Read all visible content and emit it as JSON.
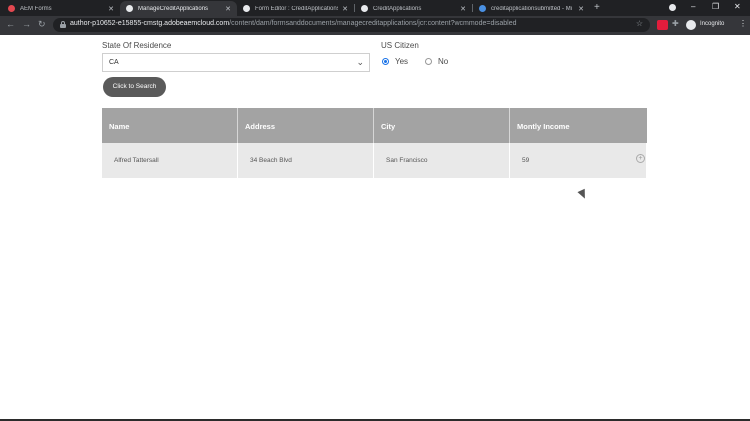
{
  "browser": {
    "tabs": [
      {
        "title": "AEM Forms",
        "icon": "adobe-icon",
        "color": "#e34850",
        "active": false
      },
      {
        "title": "ManageCreditApplications",
        "icon": "globe-icon",
        "color": "#e8eaed",
        "active": true
      },
      {
        "title": "Form Editor : CreditApplications",
        "icon": "globe-icon",
        "color": "#e8eaed",
        "active": false
      },
      {
        "title": "CreditApplications",
        "icon": "globe-icon",
        "color": "#e8eaed",
        "active": false
      },
      {
        "title": "creditapplicationsubmitted - Mi",
        "icon": "azure-icon",
        "color": "#4a90e2",
        "active": false
      }
    ],
    "new_tab": "+",
    "window_controls": {
      "minimize": "–",
      "maximize": "❐",
      "close": "✕"
    },
    "url_host": "author-p10652-e15855-cmstg.adobeaemcloud.com",
    "url_path": "/content/dam/formsanddocuments/managecreditapplications/jcr:content?wcmmode=disabled",
    "incognito_label": "Incognito"
  },
  "form": {
    "state_label": "State Of Residence",
    "state_value": "CA",
    "citizen_label": "US Citizen",
    "citizen_options": [
      "Yes",
      "No"
    ],
    "citizen_selected": "Yes",
    "search_button": "Click to Search"
  },
  "table": {
    "columns": [
      "Name",
      "Address",
      "City",
      "Montly Income"
    ],
    "rows": [
      [
        "Alfred Tattersall",
        "34 Beach Blvd",
        "San Francisco",
        "59"
      ]
    ]
  }
}
